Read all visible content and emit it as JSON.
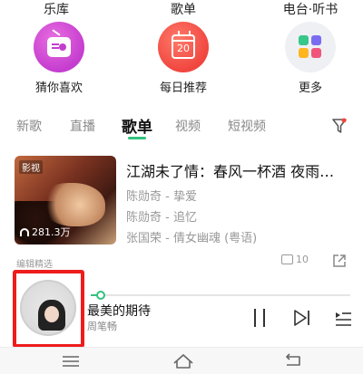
{
  "top_labels": [
    "乐库",
    "歌单",
    "电台·听书"
  ],
  "quick": [
    {
      "label": "猜你喜欢",
      "icon": "radio-icon",
      "color": "#c53dcf"
    },
    {
      "label": "每日推荐",
      "icon": "calendar-icon",
      "calendar_number": "20",
      "color": "#f0463f"
    },
    {
      "label": "更多",
      "icon": "apps-grid-icon"
    }
  ],
  "tabs": [
    {
      "label": "新歌",
      "active": false
    },
    {
      "label": "直播",
      "active": false
    },
    {
      "label": "歌单",
      "active": true
    },
    {
      "label": "视频",
      "active": false
    },
    {
      "label": "短视频",
      "active": false
    }
  ],
  "playlist": {
    "badge": "影视",
    "plays": "281.3万",
    "title": "江湖未了情：春风一杯酒  夜雨…",
    "tracks": [
      "陈勋奇 - 挚爱",
      "陈勋奇 - 追忆",
      "张国荣 - 倩女幽魂 (粤语)"
    ],
    "caption": "编辑精选",
    "comment_count": "10"
  },
  "player": {
    "title": "最美的期待",
    "artist": "周笔畅",
    "progress": 0.04
  },
  "colors": {
    "accent": "#31c27c",
    "highlight": "#ee1c1c"
  }
}
